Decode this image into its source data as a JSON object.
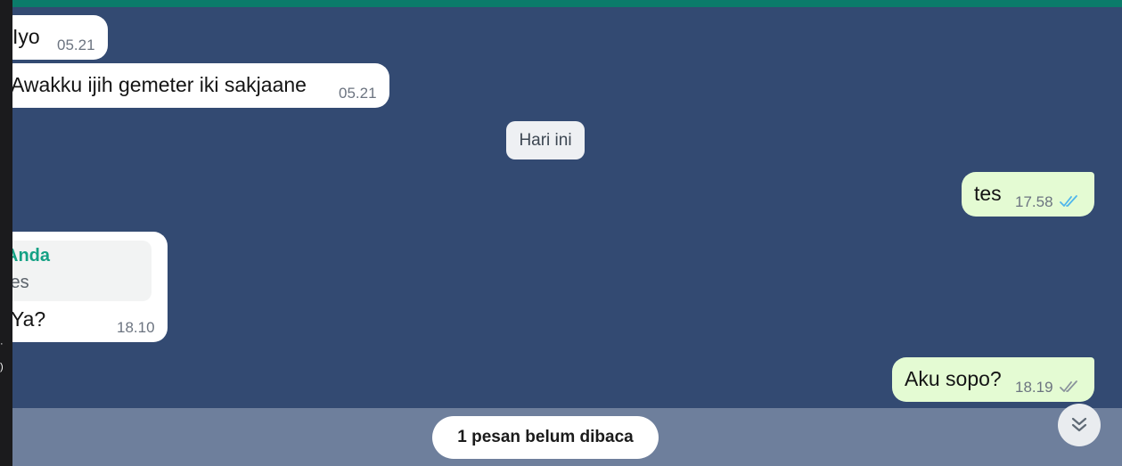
{
  "messages": [
    {
      "direction": "in",
      "text": "Iyo",
      "time": "05.21"
    },
    {
      "direction": "in",
      "text": "Awakku ijih gemeter iki sakjaane",
      "time": "05.21"
    },
    {
      "direction": "out",
      "text": "tes",
      "time": "17.58",
      "status": "read"
    },
    {
      "direction": "in",
      "reply_to": {
        "name": "Anda",
        "text": "tes"
      },
      "text": "Ya?",
      "time": "18.10"
    },
    {
      "direction": "out",
      "text": "Aku sopo?",
      "time": "18.19",
      "status": "delivered"
    }
  ],
  "date_divider": "Hari ini",
  "unread_banner": "1 pesan belum dibaca",
  "icons": {
    "read_ticks": "double-check-icon",
    "scroll_down": "double-chevron-down-icon"
  },
  "colors": {
    "chat_background": "#334a72",
    "top_bar": "#0b7b6a",
    "incoming_bubble": "#ffffff",
    "outgoing_bubble": "#e4fbd3",
    "read_ticks": "#4fb6ec",
    "delivered_ticks": "#8a939c",
    "reply_name": "#14a184"
  }
}
